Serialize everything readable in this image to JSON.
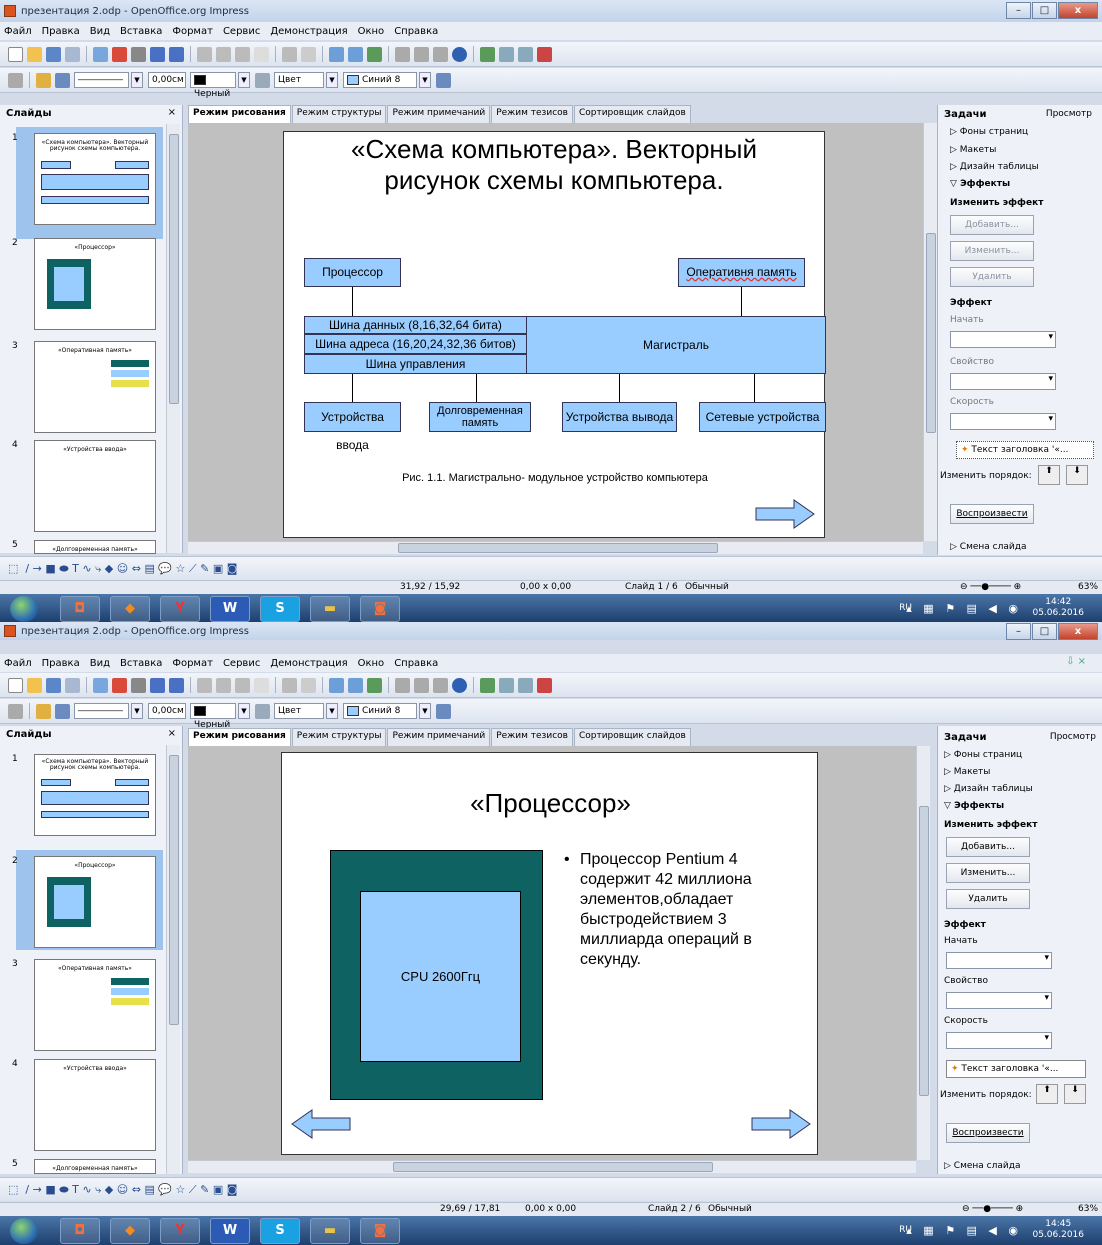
{
  "window1": {
    "title": "презентация 2.odp - OpenOffice.org Impress",
    "menu": [
      "Файл",
      "Правка",
      "Вид",
      "Вставка",
      "Формат",
      "Сервис",
      "Демонстрация",
      "Окно",
      "Справка"
    ],
    "line_width": "0,00см",
    "line_color": "Черный",
    "fill_type": "Цвет",
    "fill_color": "Синий 8",
    "slides_header": "Слайды",
    "tabs": [
      "Режим рисования",
      "Режим структуры",
      "Режим примечаний",
      "Режим тезисов",
      "Сортировщик слайдов"
    ],
    "slide": {
      "title": "«Схема компьютера». Векторный рисунок схемы компьютера.",
      "processor": "Процессор",
      "ram": "Оперативня память",
      "bus_data": "Шина данных (8,16,32,64 бита)",
      "bus_addr": "Шина адреса (16,20,24,32,36 битов)",
      "bus_ctrl": "Шина управления",
      "backbone": "Магистраль",
      "input": "Устройства ввода",
      "storage": "Долговременная память",
      "output": "Устройства вывода",
      "network": "Сетевые устройства",
      "caption": "Рис. 1.1. Магистрально- модульное устройство компьютера"
    },
    "task": {
      "title": "Задачи",
      "view": "Просмотр",
      "sections": [
        "Фоны страниц",
        "Макеты",
        "Дизайн таблицы",
        "Эффекты"
      ],
      "change_effect": "Изменить эффект",
      "add": "Добавить...",
      "modify": "Изменить...",
      "delete": "Удалить",
      "effect": "Эффект",
      "start": "Начать",
      "property": "Свойство",
      "speed": "Скорость",
      "effect_item": "Текст заголовка '«...",
      "reorder": "Изменить порядок:",
      "play": "Воспроизвести",
      "slide_change": "Смена слайда"
    },
    "status": {
      "pos": "31,92 / 15,92",
      "size": "0,00 x 0,00",
      "slide": "Слайд 1 / 6",
      "layout": "Обычный",
      "zoom": "63%"
    },
    "clock": {
      "time": "14:42",
      "date": "05.06.2016"
    }
  },
  "window2": {
    "title": "презентация 2.odp - OpenOffice.org Impress",
    "slide": {
      "title": "«Процессор»",
      "cpu_label": "CPU 2600Ггц",
      "bullet": "Процессор Pentium 4 содержит 42 миллиона элементов,обладает быстродействием 3 миллиарда операций в секунду."
    },
    "status": {
      "pos": "29,69 / 17,81",
      "size": "0,00 x 0,00",
      "slide": "Слайд 2 / 6",
      "layout": "Обычный",
      "zoom": "63%"
    },
    "clock": {
      "time": "14:45",
      "date": "05.06.2016"
    }
  },
  "thumbs": [
    {
      "num": "1",
      "title": "«Схема компьютера». Векторный рисунок схемы компьютера."
    },
    {
      "num": "2",
      "title": "«Процессор»"
    },
    {
      "num": "3",
      "title": "«Оперативная память»"
    },
    {
      "num": "4",
      "title": "«Устройства ввода»"
    },
    {
      "num": "5",
      "title": "«Долговременная память»"
    }
  ],
  "taskbar": {
    "lang": "RU"
  }
}
